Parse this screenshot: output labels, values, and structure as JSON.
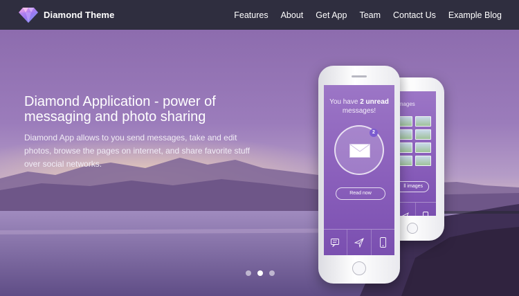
{
  "brand": {
    "name": "Diamond Theme",
    "logo_icon": "diamond-icon",
    "logo_colors": [
      "#f3a6e5",
      "#a779f2",
      "#6bb9f5"
    ]
  },
  "nav": {
    "items": [
      {
        "label": "Features"
      },
      {
        "label": "About"
      },
      {
        "label": "Get App"
      },
      {
        "label": "Team"
      },
      {
        "label": "Contact Us"
      },
      {
        "label": "Example Blog"
      }
    ]
  },
  "hero": {
    "title": "Diamond Application - power of messaging and photo sharing",
    "description": "Diamond App allows to you send messages, take and edit photos, browse the pages on internet, and share favorite stuff over social networks."
  },
  "phone_front": {
    "message_prefix": "You have",
    "message_count_text": "2 unread",
    "message_suffix": "messages!",
    "badge_count": "2",
    "button_label": "Read now",
    "tab_icons": [
      "chat-icon",
      "paper-plane-icon",
      "phone-icon"
    ]
  },
  "phone_back": {
    "title": "images",
    "button_label": "ll images",
    "tab_icons": [
      "paper-plane-icon",
      "phone-icon"
    ]
  },
  "carousel": {
    "slide_count": 3,
    "active_slide": 2
  },
  "colors": {
    "navbar_bg": "#2f2e3f",
    "screen_purple": "#8a5fbb",
    "sky_top": "#8e6fb0",
    "horizon": "#e9c9a9"
  }
}
